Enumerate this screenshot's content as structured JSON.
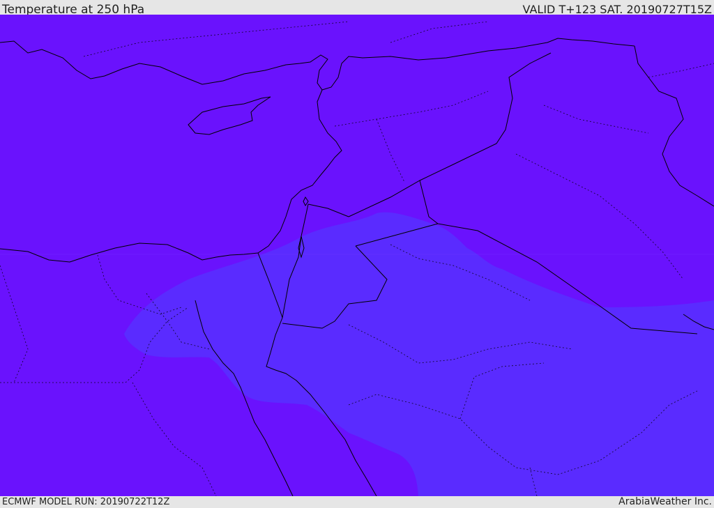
{
  "header": {
    "title": "Temperature at 250 hPa",
    "valid": "VALID T+123 SAT. 20190727T15Z"
  },
  "footer": {
    "model_run": "ECMWF MODEL RUN: 20190722T12Z",
    "credit": "ArabiaWeather Inc."
  },
  "map": {
    "region": "Eastern Mediterranean and Middle East",
    "colors": {
      "field_cold": "#6a12fd",
      "field_warm": "#5a2bff",
      "coastline": "#000000",
      "border": "#000000"
    }
  }
}
